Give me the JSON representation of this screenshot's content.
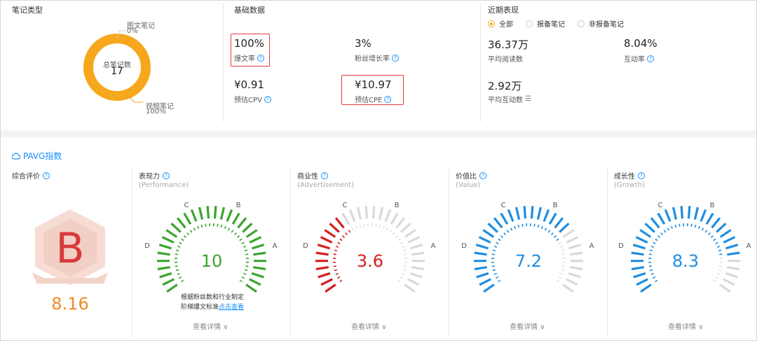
{
  "note_types": {
    "title": "笔记类型",
    "center_label": "总笔记数",
    "center_value": "17",
    "image_label": "图文笔记",
    "image_pct": "0%",
    "video_label": "视频笔记",
    "video_pct": "100%",
    "video_fraction": 1.0
  },
  "basic": {
    "title": "基础数据",
    "metrics": [
      {
        "value": "100%",
        "label": "爆文率"
      },
      {
        "value": "3%",
        "label": "粉丝增长率"
      },
      {
        "value": "¥0.91",
        "label": "预估CPV"
      },
      {
        "value": "¥10.97",
        "label": "预估CPE"
      }
    ]
  },
  "recent": {
    "title": "近期表现",
    "filters": [
      "全部",
      "报备笔记",
      "非报备笔记"
    ],
    "selected": 0,
    "metrics": [
      {
        "value": "36.37万",
        "label": "平均阅读数"
      },
      {
        "value": "8.04%",
        "label": "互动率"
      },
      {
        "value": "2.92万",
        "label": "平均互动数"
      }
    ]
  },
  "pavg": {
    "title": "PAVG指数",
    "overall": {
      "title": "综合评价",
      "grade": "B",
      "score": "8.16"
    },
    "gauges": [
      {
        "title": "表现力",
        "sub": "(Performance)",
        "value": "10",
        "level": 1.0,
        "color": "#3aa52d"
      },
      {
        "title": "商业性",
        "sub": "(Advertisement)",
        "value": "3.6",
        "level": 0.36,
        "color": "#d81e1e"
      },
      {
        "title": "价值比",
        "sub": "(Value)",
        "value": "7.2",
        "level": 0.72,
        "color": "#1e8ee0"
      },
      {
        "title": "成长性",
        "sub": "(Growth)",
        "value": "8.3",
        "level": 0.83,
        "color": "#1e8ee0"
      }
    ],
    "letters": [
      "D",
      "C",
      "B",
      "A"
    ],
    "note_line1": "根据粉丝数和行业制定",
    "note_line2": "阶梯爆文标准",
    "note_link": "点击查看",
    "detail_label": "查看详情"
  }
}
